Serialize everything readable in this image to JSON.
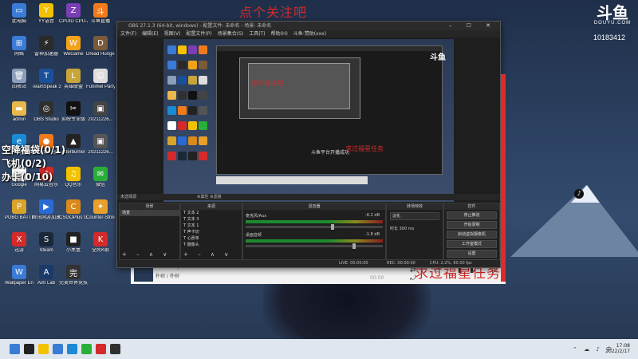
{
  "overlay": {
    "top_text": "点个关注吧",
    "bottom_text": "求过福星任务",
    "tasks": [
      "空降福袋(0/1)",
      "飞机(0/2)",
      "办卡(0/10)"
    ]
  },
  "branding": {
    "logo": "斗鱼",
    "sub": "DOUYU.COM",
    "room_id": "10183412"
  },
  "desktop_icons": [
    {
      "label": "此电脑",
      "color": "#3a7bd5",
      "glyph": "▭"
    },
    {
      "label": "YY语音",
      "color": "#f2c200",
      "glyph": "Y"
    },
    {
      "label": "CPUID CPU-Z",
      "color": "#7b3fb5",
      "glyph": "Z"
    },
    {
      "label": "斗鱼直播",
      "color": "#f27a1a",
      "glyph": "斗"
    },
    {
      "label": "网络",
      "color": "#3a7bd5",
      "glyph": "⊞"
    },
    {
      "label": "雷神加速器",
      "color": "#2a2a2a",
      "glyph": "⚡"
    },
    {
      "label": "WeGame",
      "color": "#f2a31a",
      "glyph": "W"
    },
    {
      "label": "Dread Hunger",
      "color": "#7a5a3a",
      "glyph": "D"
    },
    {
      "label": "回收站",
      "color": "#8aa0b8",
      "glyph": "🗑"
    },
    {
      "label": "TeamSpeak 3",
      "color": "#1a4f9a",
      "glyph": "T"
    },
    {
      "label": "英雄联盟",
      "color": "#c9a43a",
      "glyph": "L"
    },
    {
      "label": "Funimel Party",
      "color": "#dddddd",
      "glyph": "☺"
    },
    {
      "label": "admin",
      "color": "#e8b84a",
      "glyph": "▬"
    },
    {
      "label": "OBS Studio",
      "color": "#303030",
      "glyph": "◎"
    },
    {
      "label": "剪映专业版",
      "color": "#111111",
      "glyph": "✂"
    },
    {
      "label": "20211226...",
      "color": "#444444",
      "glyph": "▣"
    },
    {
      "label": "Edge",
      "color": "#1a8ad5",
      "glyph": "e"
    },
    {
      "label": "游戏加速",
      "color": "#f27a1a",
      "glyph": "●"
    },
    {
      "label": "Afterburner",
      "color": "#222222",
      "glyph": "▲"
    },
    {
      "label": "20211226...",
      "color": "#555555",
      "glyph": "▣"
    },
    {
      "label": "Google",
      "color": "#ffffff",
      "glyph": "◉"
    },
    {
      "label": "网易云音乐",
      "color": "#d42a2a",
      "glyph": "♪"
    },
    {
      "label": "QQ音乐",
      "color": "#f2c200",
      "glyph": "♫"
    },
    {
      "label": "微信",
      "color": "#2aae3a",
      "glyph": "✉"
    },
    {
      "label": "PUBG BATTLEGR...",
      "color": "#d9a42a",
      "glyph": "P"
    },
    {
      "label": "腾讯网游加速器",
      "color": "#2a6ad5",
      "glyph": "▶"
    },
    {
      "label": "CSGOPlus Global Offe",
      "color": "#d98a1a",
      "glyph": "C"
    },
    {
      "label": "Counter-Strike",
      "color": "#e8a02a",
      "glyph": "✦"
    },
    {
      "label": "迅游",
      "color": "#d42a2a",
      "glyph": "X"
    },
    {
      "label": "Steam",
      "color": "#1b2838",
      "glyph": "S"
    },
    {
      "label": "小黑盒",
      "color": "#222222",
      "glyph": "■"
    },
    {
      "label": "全民K歌",
      "color": "#d42a2a",
      "glyph": "K"
    },
    {
      "label": "Wallpaper Engine",
      "color": "#3a7bd5",
      "glyph": "W"
    },
    {
      "label": "Aim Lab",
      "color": "#1a3a6a",
      "glyph": "A"
    },
    {
      "label": "完美世界竞技平台",
      "color": "#333333",
      "glyph": "完"
    }
  ],
  "player": {
    "song": "New Boy ❤",
    "artist": "朴树 / 朴树",
    "controls": "⇄ ◁ ▮▮ ▷ ⤾",
    "time": "00:00"
  },
  "obs": {
    "title": "OBS 27.1.3 (64-bit, windows) - 配置文件: 未命名 - 场景: 未命名",
    "window_controls": "– ☐ ✕",
    "menu": [
      "文件(F)",
      "编辑(E)",
      "视图(V)",
      "配置文件(P)",
      "场景集合(S)",
      "工具(T)",
      "帮助(H)",
      "斗鱼·赞助(xxx)"
    ],
    "preview_logo": "斗鱼",
    "preview_red1": "点个关注吧",
    "preview_red2": "求过福星任务",
    "preview_msg": "斗鱼平台开播成功",
    "scene_status": "未选择源",
    "scene_btns": "⚙属性  ⚙滤镜",
    "docks": {
      "scenes": {
        "title": "场景",
        "items": [
          "场景"
        ]
      },
      "sources": {
        "title": "来源",
        "items": [
          "文本 2",
          "文本 3",
          "文本 1",
          "声卡切",
          "心愿单",
          "摄像头"
        ]
      },
      "mixer": {
        "title": "混音器",
        "channels": [
          {
            "name": "麦克风/Aux",
            "db": "-6.2 dB",
            "level": 0.62
          },
          {
            "name": "桌面音频",
            "db": "-1.8 dB",
            "level": 0.78
          }
        ]
      },
      "transitions": {
        "title": "转场特效",
        "type": "淡化",
        "duration_label": "时长",
        "duration": "300 ms"
      },
      "controls": {
        "title": "控件",
        "buttons": [
          "停止推流",
          "开始录制",
          "启动虚拟摄像机",
          "工作室模式",
          "设置",
          "退出"
        ]
      }
    },
    "status": {
      "live": "LIVE: 00:00:00",
      "rec": "REC: 00:00:00",
      "cpu": "CPU: 2.2%, 60.00 fps",
      "kbps": "kb/s: 0"
    },
    "dock_footer": "+ – ∧ ∨"
  },
  "taskbar": {
    "time": "17:08",
    "date": "2022/2/17",
    "tray": "⌃ ☁ ♪ 中",
    "icons": [
      "#3a7bd5",
      "#222222",
      "#f2c200",
      "#3a7bd5",
      "#1a8ad5",
      "#2aae3a",
      "#d42a2a",
      "#303030"
    ]
  }
}
